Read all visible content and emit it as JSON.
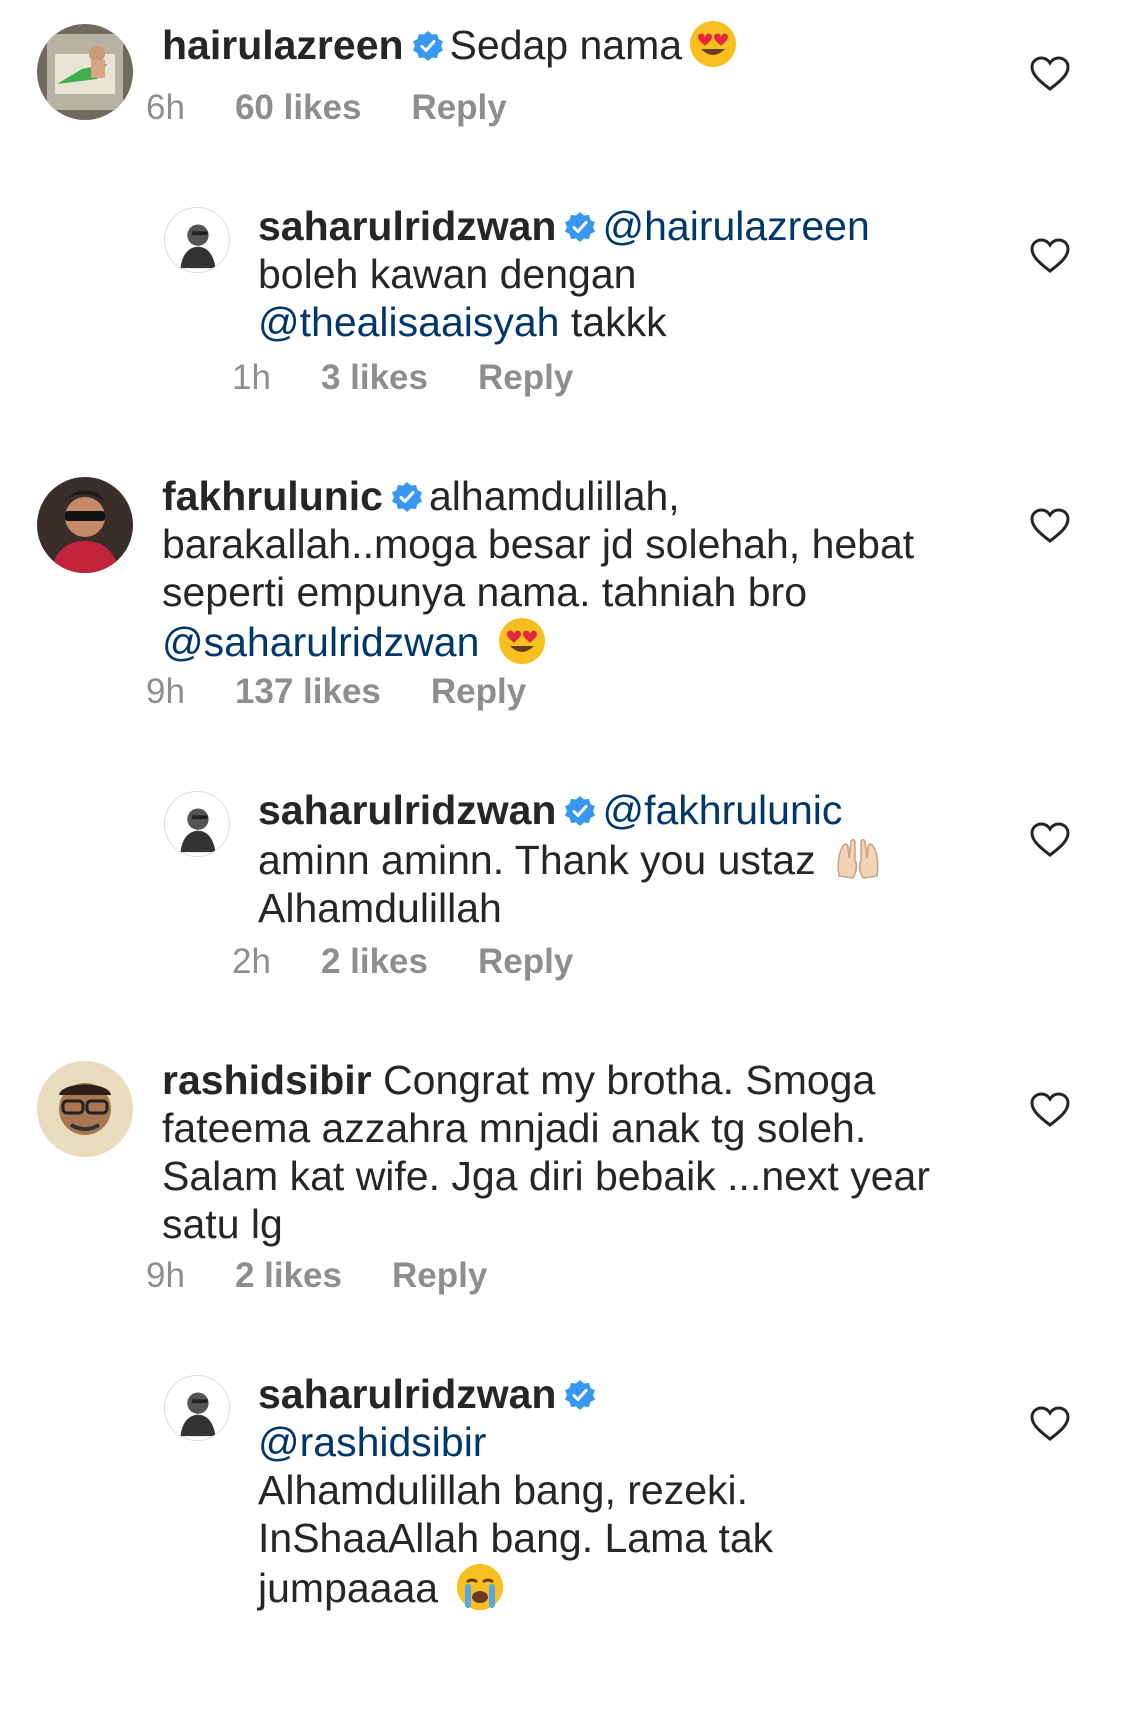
{
  "comments": [
    {
      "username": "hairulazreen",
      "verified": true,
      "mention": "",
      "text": "Sedap nama",
      "emoji": "heart-eyes-emoji",
      "time": "6h",
      "likes": "60 likes",
      "reply_label": "Reply"
    },
    {
      "username": "saharulridzwan",
      "verified": true,
      "mention": "@hairulazreen",
      "line2": "boleh kawan dengan",
      "mention2": "@thealisaaisyah",
      "text_after": "takkk",
      "time": "1h",
      "likes": "3 likes",
      "reply_label": "Reply"
    },
    {
      "username": "fakhrulunic",
      "verified": true,
      "text": "alhamdulillah, barakallah..moga besar jd solehah, hebat seperti empunya nama. tahniah bro",
      "mention": "@saharulridzwan",
      "emoji": "heart-eyes-emoji",
      "time": "9h",
      "likes": "137 likes",
      "reply_label": "Reply"
    },
    {
      "username": "saharulridzwan",
      "verified": true,
      "mention": "@fakhrulunic",
      "text": "aminn aminn. Thank you ustaz",
      "emoji": "raised-hands-emoji",
      "text2": "Alhamdulillah",
      "time": "2h",
      "likes": "2 likes",
      "reply_label": "Reply"
    },
    {
      "username": "rashidsibir",
      "verified": false,
      "text": "Congrat my brotha. Smoga fateema azzahra mnjadi anak tg soleh. Salam kat wife.  Jga diri bebaik ...next year satu lg",
      "time": "9h",
      "likes": "2 likes",
      "reply_label": "Reply"
    },
    {
      "username": "saharulridzwan",
      "verified": true,
      "mention": "@rashidsibir",
      "text": "Alhamdulillah bang, rezeki. InShaaAllah bang. Lama tak jumpaaaa",
      "emoji": "crying-face-emoji"
    }
  ],
  "colors": {
    "text": "#262626",
    "meta": "#8e8e8e",
    "mention": "#00376b",
    "verified": "#3897f0",
    "heart_outline": "#262626"
  }
}
